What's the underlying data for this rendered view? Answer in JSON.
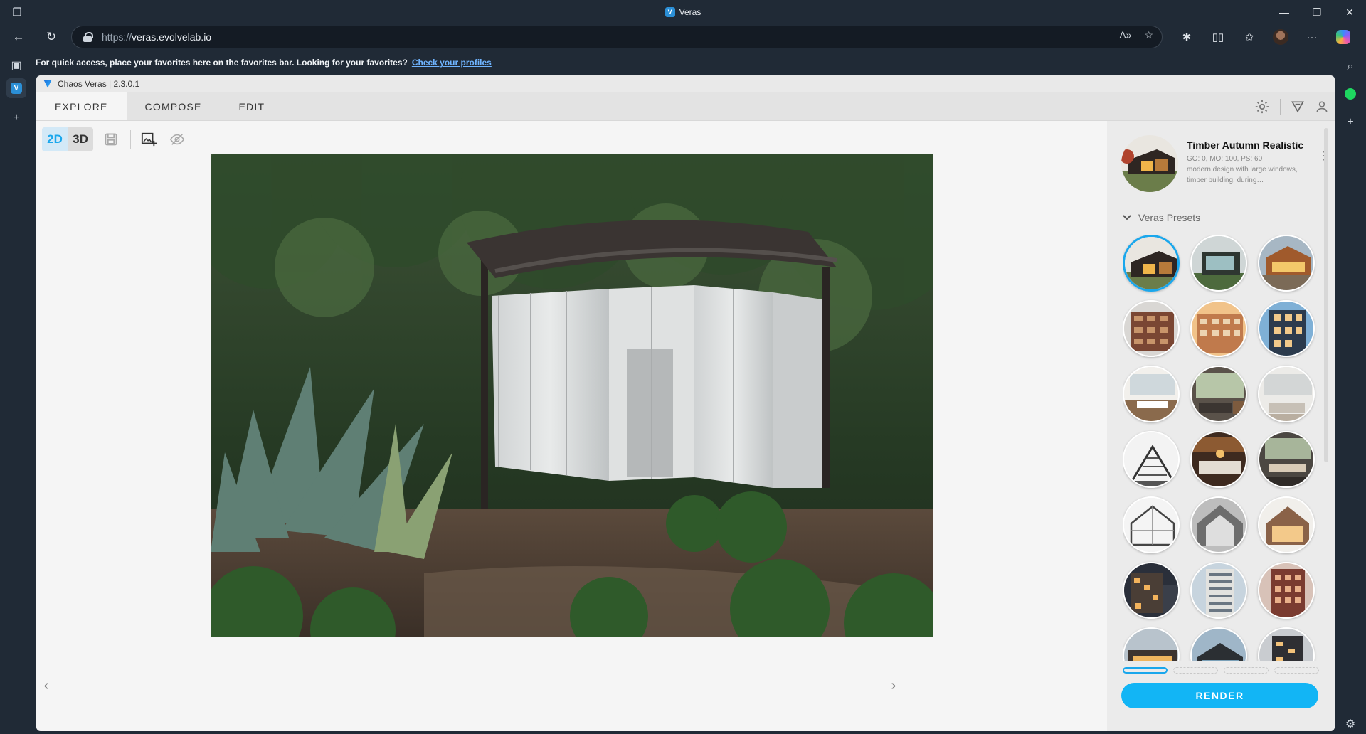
{
  "browser": {
    "window_title": "Veras",
    "url_protocol": "https://",
    "url_host": "veras.evolvelab.io",
    "favorites_message": "For quick access, place your favorites here on the favorites bar. Looking for your favorites?",
    "favorites_link": "Check your profiles"
  },
  "app": {
    "title": "Chaos Veras | 2.3.0.1",
    "tabs": [
      {
        "label": "EXPLORE",
        "active": true
      },
      {
        "label": "COMPOSE",
        "active": false
      },
      {
        "label": "EDIT",
        "active": false
      }
    ],
    "view_modes": {
      "mode_2d": "2D",
      "mode_3d": "3D",
      "active": "2D"
    },
    "accent_color": "#1aa7ec"
  },
  "panel": {
    "selected_preset": {
      "name": "Timber Autumn Realistic",
      "meta": "GO: 0, MO: 100, PS: 60",
      "description": "modern design with large windows, timber building, during…"
    },
    "presets_title": "Veras Presets",
    "render_label": "RENDER"
  }
}
